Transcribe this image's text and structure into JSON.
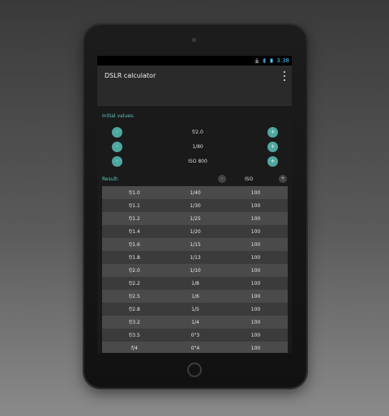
{
  "status": {
    "time": "3:38"
  },
  "app": {
    "title": "DSLR calculator"
  },
  "initial": {
    "label": "Initial values:",
    "aperture": {
      "value": "f/2.0",
      "minus": "-",
      "plus": "+"
    },
    "shutter": {
      "value": "1/80",
      "minus": "-",
      "plus": "+"
    },
    "iso": {
      "value": "ISO 800",
      "minus": "-",
      "plus": "+"
    }
  },
  "result": {
    "label": "Result:",
    "minus": "-",
    "plus": "+",
    "fixed_param": "ISO",
    "rows": [
      [
        "f/1.0",
        "1/40",
        "100"
      ],
      [
        "f/1.1",
        "1/30",
        "100"
      ],
      [
        "f/1.2",
        "1/25",
        "100"
      ],
      [
        "f/1.4",
        "1/20",
        "100"
      ],
      [
        "f/1.6",
        "1/15",
        "100"
      ],
      [
        "f/1.8",
        "1/13",
        "100"
      ],
      [
        "f/2.0",
        "1/10",
        "100"
      ],
      [
        "f/2.2",
        "1/8",
        "100"
      ],
      [
        "f/2.5",
        "1/6",
        "100"
      ],
      [
        "f/2.8",
        "1/5",
        "100"
      ],
      [
        "f/3.2",
        "1/4",
        "100"
      ],
      [
        "f/3.5",
        "0\"3",
        "100"
      ],
      [
        "f/4",
        "0\"4",
        "100"
      ]
    ]
  },
  "colors": {
    "accent": "#5cc7bd",
    "button": "#4fa8a0"
  }
}
